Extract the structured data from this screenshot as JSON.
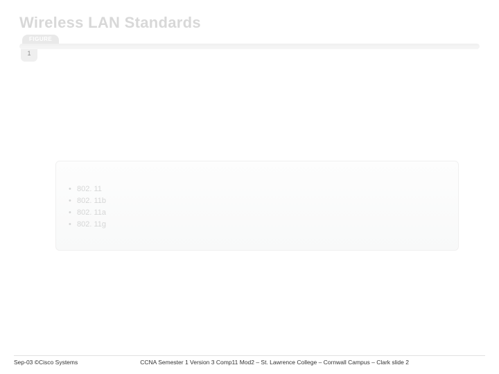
{
  "header": {
    "title": "Wireless LAN Standards",
    "figure_label": "FIGURE",
    "page_tab": "1"
  },
  "standards": {
    "items": [
      "802. 11",
      "802. 11b",
      "802. 11a",
      "802. 11g"
    ]
  },
  "footer": {
    "left": "Sep-03 ©Cisco Systems",
    "right": "CCNA Semester 1 Version 3 Comp11 Mod2 – St. Lawrence College – Cornwall Campus – Clark slide 2"
  }
}
